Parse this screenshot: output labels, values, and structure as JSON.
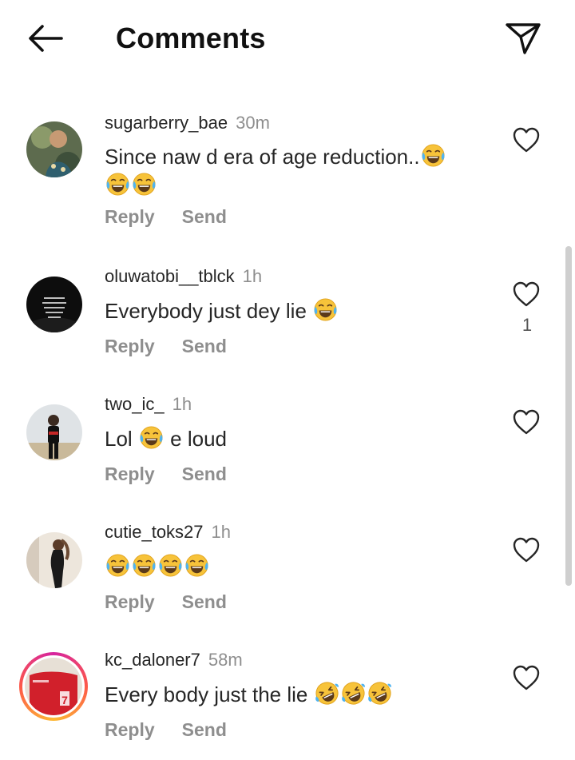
{
  "header": {
    "title": "Comments",
    "back_icon": "arrow-left-icon",
    "send_icon": "paper-plane-icon"
  },
  "comments": [
    {
      "username": "sugarberry_bae",
      "time": "30m",
      "text_line1": "Since naw d era of age reduction..",
      "likes": "",
      "reply_label": "Reply",
      "send_label": "Send"
    },
    {
      "username": "oluwatobi__tblck",
      "time": "1h",
      "text": "Everybody just dey lie",
      "likes": "1",
      "reply_label": "Reply",
      "send_label": "Send"
    },
    {
      "username": "two_ic_",
      "time": "1h",
      "text_before": "Lol",
      "text_after": "e loud",
      "likes": "",
      "reply_label": "Reply",
      "send_label": "Send"
    },
    {
      "username": "cutie_toks27",
      "time": "1h",
      "likes": "",
      "reply_label": "Reply",
      "send_label": "Send"
    },
    {
      "username": "kc_daloner7",
      "time": "58m",
      "text": "Every body just the lie",
      "likes": "",
      "reply_label": "Reply",
      "send_label": "Send"
    }
  ],
  "colors": {
    "text": "#262626",
    "muted": "#8e8e8e",
    "emoji_face": "#f7c33a"
  }
}
